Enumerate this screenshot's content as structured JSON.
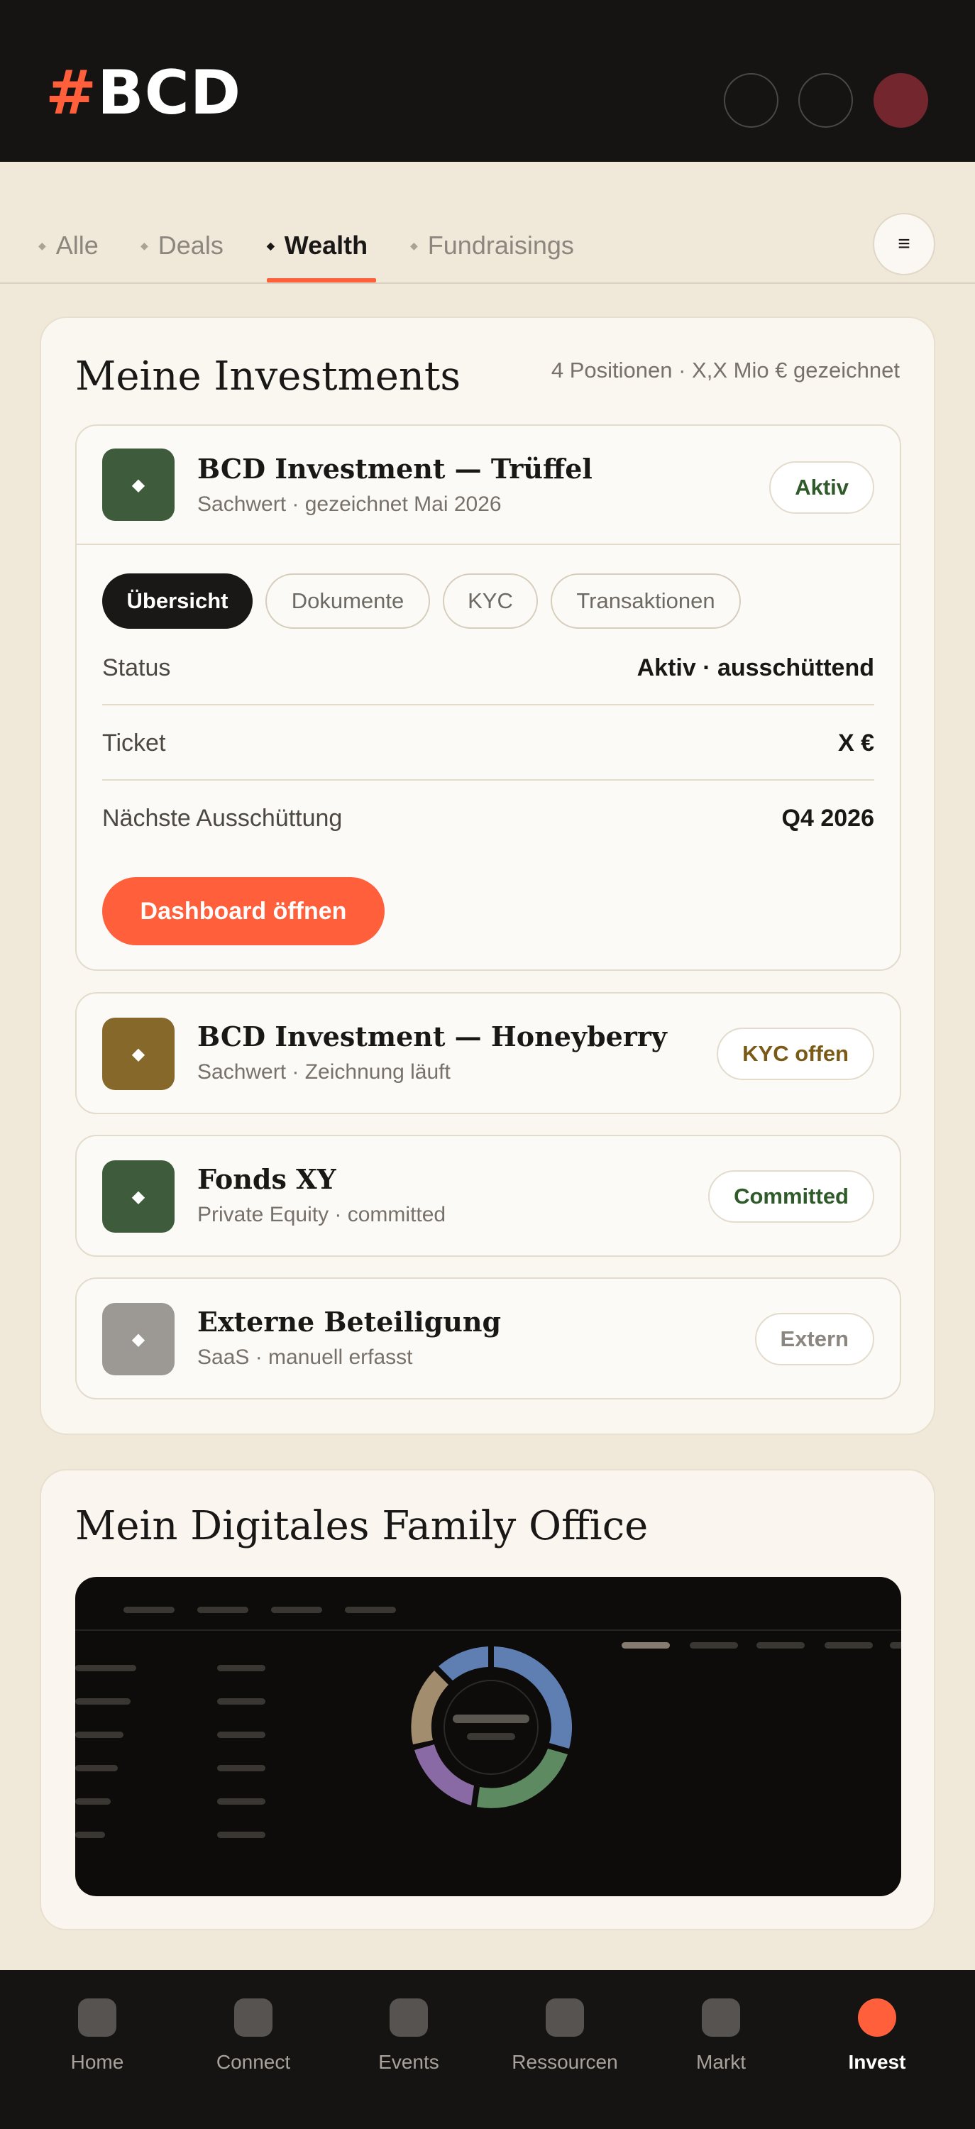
{
  "brand": {
    "hash": "#",
    "name": "BCD",
    "accent": "#ff5f3a"
  },
  "tabs": [
    {
      "label": "Alle"
    },
    {
      "label": "Deals"
    },
    {
      "label": "Wealth",
      "active": true
    },
    {
      "label": "Fundraisings"
    }
  ],
  "menu_icon": "menu-icon",
  "investments": {
    "title": "Meine Investments",
    "meta": "4 Positionen · X,X Mio € gezeichnet",
    "items": [
      {
        "name": "BCD Investment — Trüffel",
        "sub": "Sachwert · gezeichnet Mai 2026",
        "badge": "Aktiv",
        "icon_color": "#3e5b3b",
        "badge_color": "#2f5a2a",
        "expanded": true,
        "pills": [
          "Übersicht",
          "Dokumente",
          "KYC",
          "Transaktionen"
        ],
        "rows": [
          {
            "label": "Status",
            "value": "Aktiv · ausschüttend"
          },
          {
            "label": "Ticket",
            "value": "X €"
          },
          {
            "label": "Nächste Ausschüttung",
            "value": "Q4 2026"
          }
        ],
        "cta": "Dashboard öffnen"
      },
      {
        "name": "BCD Investment — Honeyberry",
        "sub": "Sachwert · Zeichnung läuft",
        "badge": "KYC offen",
        "icon_color": "#86692a",
        "badge_color": "#7a5a16"
      },
      {
        "name": "Fonds XY",
        "sub": "Private Equity · committed",
        "badge": "Committed",
        "icon_color": "#3e5b3b",
        "badge_color": "#2f5a2a"
      },
      {
        "name": "Externe Beteiligung",
        "sub": "SaaS · manuell erfasst",
        "badge": "Extern",
        "icon_color": "#9c9994",
        "badge_color": "#8b8680"
      }
    ]
  },
  "family_office": {
    "title": "Mein Digitales Family Office",
    "donut_colors": [
      "#5f7fb3",
      "#5e8a61",
      "#8a6aa5",
      "#a38d6f"
    ]
  },
  "bottom_nav": [
    {
      "label": "Home"
    },
    {
      "label": "Connect"
    },
    {
      "label": "Events"
    },
    {
      "label": "Ressourcen"
    },
    {
      "label": "Markt"
    },
    {
      "label": "Invest",
      "active": true
    }
  ]
}
